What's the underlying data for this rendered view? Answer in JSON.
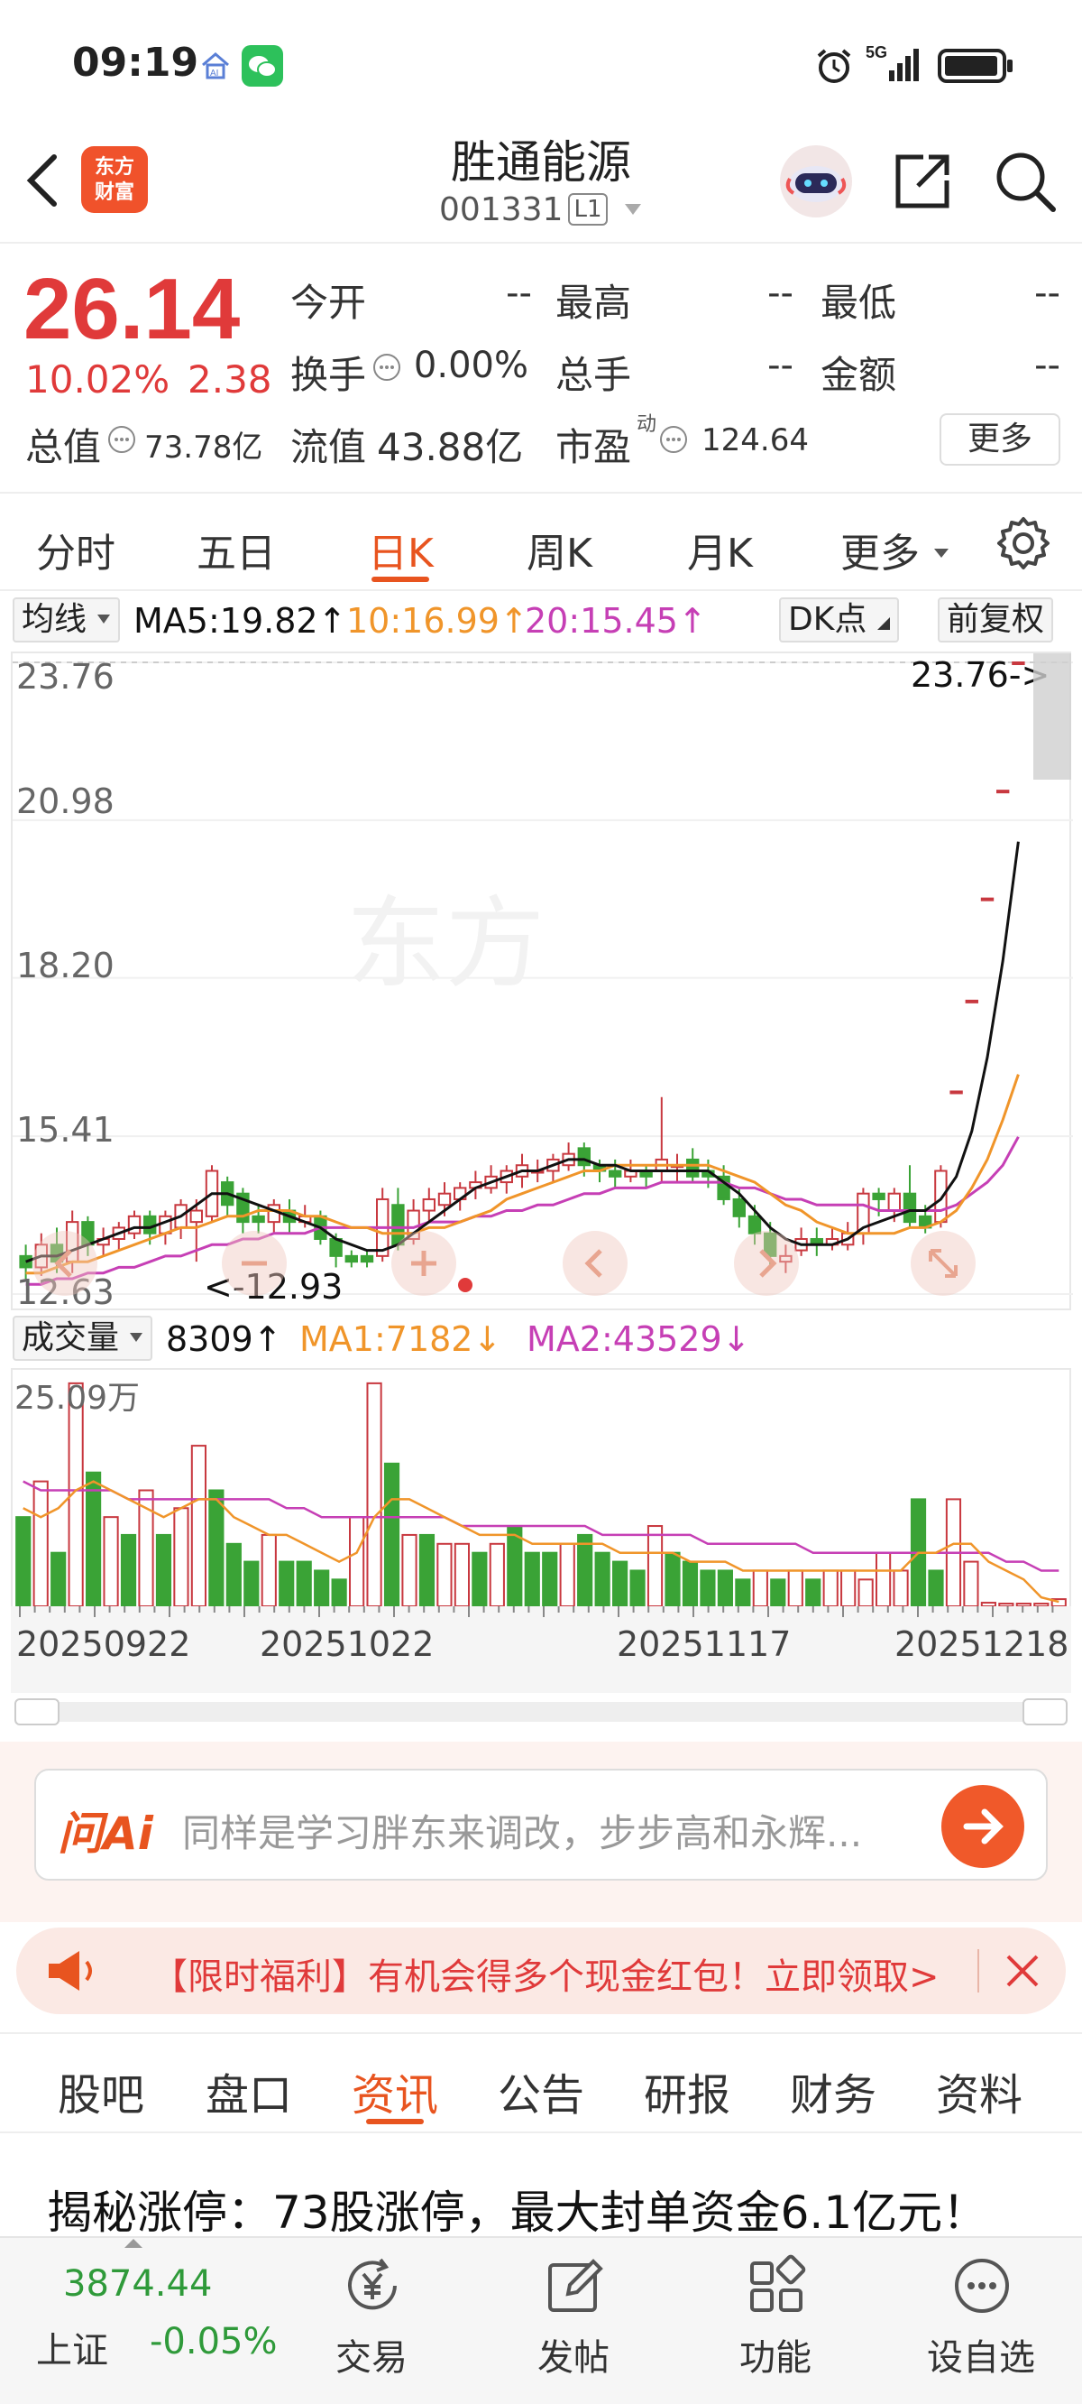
{
  "status_bar": {
    "time": "09:19",
    "network": "5G",
    "icons": [
      "home-ai-icon",
      "wechat-icon",
      "alarm-icon",
      "signal-icon",
      "battery-icon"
    ]
  },
  "header": {
    "back_icon": "back-chevron-icon",
    "logo_text_line1": "东方",
    "logo_text_line2": "财富",
    "stock_name": "胜通能源",
    "stock_code": "001331",
    "level_badge": "L1",
    "actions": [
      "robot-avatar-icon",
      "share-icon",
      "search-icon"
    ]
  },
  "quote": {
    "price": "26.14",
    "change_pct": "10.02%",
    "change_abs": "2.38",
    "open_label": "今开",
    "open_value": "--",
    "high_label": "最高",
    "high_value": "--",
    "low_label": "最低",
    "low_value": "--",
    "turnover_label": "换手",
    "turnover_value": "0.00%",
    "volume_label": "总手",
    "volume_value": "--",
    "amount_label": "金额",
    "amount_value": "--",
    "mktcap_label": "总值",
    "mktcap_value": "73.78亿",
    "float_label": "流值",
    "float_value": "43.88亿",
    "pe_label": "市盈",
    "pe_sup": "动",
    "pe_value": "124.64",
    "more_label": "更多",
    "accent_color": "#e03a3a"
  },
  "period_tabs": {
    "items": [
      "分时",
      "五日",
      "日K",
      "周K",
      "月K",
      "更多"
    ],
    "active": "日K",
    "settings_icon": "gear-icon"
  },
  "ma_legend": {
    "selector": "均线",
    "ma5": "MA5:19.82",
    "ma10": "10:16.99",
    "ma20": "20:15.45",
    "dk_button": "DK点",
    "adjust_button": "前复权"
  },
  "volume_legend": {
    "selector": "成交量",
    "volume": "8309",
    "ma1": "MA1:7182",
    "ma2": "MA2:43529",
    "max_label": "25.09万"
  },
  "chart_data": {
    "type": "candlestick",
    "price_axis_labels": [
      "23.76",
      "20.98",
      "18.20",
      "15.41",
      "12.63"
    ],
    "max_marker": "23.76->",
    "min_marker": "<-12.93",
    "date_labels": [
      "20250922",
      "20251022",
      "20251117",
      "20251218"
    ],
    "ylim": [
      12.63,
      23.76
    ],
    "colors": {
      "up": "#c8383f",
      "down": "#3aa336",
      "ma5": "#111111",
      "ma10": "#f0952a",
      "ma20": "#c63fb5"
    },
    "candles": [
      {
        "o": 13.3,
        "c": 13.1,
        "h": 13.5,
        "l": 12.9
      },
      {
        "o": 13.1,
        "c": 13.5,
        "h": 13.7,
        "l": 12.95
      },
      {
        "o": 13.5,
        "c": 13.2,
        "h": 13.8,
        "l": 13.0
      },
      {
        "o": 13.2,
        "c": 13.9,
        "h": 14.1,
        "l": 13.0
      },
      {
        "o": 13.9,
        "c": 13.5,
        "h": 14.0,
        "l": 13.3
      },
      {
        "o": 13.5,
        "c": 13.6,
        "h": 13.8,
        "l": 13.3
      },
      {
        "o": 13.6,
        "c": 13.8,
        "h": 13.9,
        "l": 13.4
      },
      {
        "o": 13.7,
        "c": 14.0,
        "h": 14.1,
        "l": 13.6
      },
      {
        "o": 14.0,
        "c": 13.7,
        "h": 14.1,
        "l": 13.5
      },
      {
        "o": 13.7,
        "c": 14.0,
        "h": 14.1,
        "l": 13.5
      },
      {
        "o": 13.8,
        "c": 14.2,
        "h": 14.3,
        "l": 13.6
      },
      {
        "o": 13.9,
        "c": 14.1,
        "h": 14.3,
        "l": 13.2
      },
      {
        "o": 14.0,
        "c": 14.8,
        "h": 14.9,
        "l": 13.9
      },
      {
        "o": 14.6,
        "c": 14.2,
        "h": 14.7,
        "l": 14.0
      },
      {
        "o": 14.4,
        "c": 13.9,
        "h": 14.5,
        "l": 13.7
      },
      {
        "o": 14.0,
        "c": 13.9,
        "h": 14.2,
        "l": 13.7
      },
      {
        "o": 13.9,
        "c": 14.2,
        "h": 14.3,
        "l": 13.7
      },
      {
        "o": 14.1,
        "c": 13.9,
        "h": 14.3,
        "l": 13.7
      },
      {
        "o": 13.9,
        "c": 14.0,
        "h": 14.2,
        "l": 13.8
      },
      {
        "o": 14.0,
        "c": 13.6,
        "h": 14.1,
        "l": 13.5
      },
      {
        "o": 13.6,
        "c": 13.3,
        "h": 13.7,
        "l": 13.1
      },
      {
        "o": 13.3,
        "c": 13.2,
        "h": 13.4,
        "l": 13.1
      },
      {
        "o": 13.3,
        "c": 13.2,
        "h": 13.4,
        "l": 13.1
      },
      {
        "o": 13.3,
        "c": 14.3,
        "h": 14.5,
        "l": 13.2
      },
      {
        "o": 14.2,
        "c": 13.5,
        "h": 14.5,
        "l": 13.4
      },
      {
        "o": 13.6,
        "c": 14.1,
        "h": 14.3,
        "l": 13.5
      },
      {
        "o": 14.1,
        "c": 14.3,
        "h": 14.5,
        "l": 13.9
      },
      {
        "o": 14.2,
        "c": 14.4,
        "h": 14.6,
        "l": 14.0
      },
      {
        "o": 14.3,
        "c": 14.5,
        "h": 14.6,
        "l": 14.1
      },
      {
        "o": 14.5,
        "c": 14.6,
        "h": 14.8,
        "l": 14.3
      },
      {
        "o": 14.5,
        "c": 14.7,
        "h": 14.9,
        "l": 14.4
      },
      {
        "o": 14.6,
        "c": 14.8,
        "h": 14.9,
        "l": 14.4
      },
      {
        "o": 14.7,
        "c": 14.9,
        "h": 15.1,
        "l": 14.5
      },
      {
        "o": 14.8,
        "c": 14.8,
        "h": 15.0,
        "l": 14.6
      },
      {
        "o": 14.8,
        "c": 15.0,
        "h": 15.1,
        "l": 14.6
      },
      {
        "o": 14.9,
        "c": 15.1,
        "h": 15.3,
        "l": 14.8
      },
      {
        "o": 15.2,
        "c": 14.9,
        "h": 15.3,
        "l": 14.7
      },
      {
        "o": 14.9,
        "c": 14.8,
        "h": 15.0,
        "l": 14.6
      },
      {
        "o": 14.8,
        "c": 14.7,
        "h": 15.0,
        "l": 14.5
      },
      {
        "o": 14.7,
        "c": 14.8,
        "h": 15.0,
        "l": 14.6
      },
      {
        "o": 14.8,
        "c": 14.7,
        "h": 14.9,
        "l": 14.5
      },
      {
        "o": 14.8,
        "c": 15.0,
        "h": 16.1,
        "l": 14.6
      },
      {
        "o": 14.9,
        "c": 14.9,
        "h": 15.1,
        "l": 14.6
      },
      {
        "o": 15.0,
        "c": 14.7,
        "h": 15.2,
        "l": 14.6
      },
      {
        "o": 14.8,
        "c": 14.7,
        "h": 15.0,
        "l": 14.5
      },
      {
        "o": 14.7,
        "c": 14.3,
        "h": 14.9,
        "l": 14.2
      },
      {
        "o": 14.3,
        "c": 14.0,
        "h": 14.5,
        "l": 13.8
      },
      {
        "o": 14.0,
        "c": 13.7,
        "h": 14.2,
        "l": 13.5
      },
      {
        "o": 13.7,
        "c": 13.3,
        "h": 13.9,
        "l": 13.1
      },
      {
        "o": 13.2,
        "c": 13.3,
        "h": 13.5,
        "l": 13.0
      },
      {
        "o": 13.4,
        "c": 13.6,
        "h": 13.8,
        "l": 13.3
      },
      {
        "o": 13.6,
        "c": 13.5,
        "h": 13.8,
        "l": 13.3
      },
      {
        "o": 13.5,
        "c": 13.6,
        "h": 13.8,
        "l": 13.4
      },
      {
        "o": 13.5,
        "c": 13.7,
        "h": 13.9,
        "l": 13.4
      },
      {
        "o": 13.7,
        "c": 14.4,
        "h": 14.5,
        "l": 13.5
      },
      {
        "o": 14.4,
        "c": 14.3,
        "h": 14.5,
        "l": 14.0
      },
      {
        "o": 14.1,
        "c": 14.4,
        "h": 14.5,
        "l": 13.9
      },
      {
        "o": 14.4,
        "c": 13.9,
        "h": 14.9,
        "l": 13.8
      },
      {
        "o": 14.0,
        "c": 13.8,
        "h": 14.2,
        "l": 13.7
      },
      {
        "o": 13.9,
        "c": 14.8,
        "h": 14.9,
        "l": 13.8
      },
      {
        "o": 16.2,
        "c": 16.2,
        "h": 16.2,
        "l": 16.2
      },
      {
        "o": 17.8,
        "c": 17.8,
        "h": 17.8,
        "l": 17.8
      },
      {
        "o": 19.6,
        "c": 19.6,
        "h": 19.6,
        "l": 19.6
      },
      {
        "o": 21.5,
        "c": 21.5,
        "h": 21.5,
        "l": 21.5
      },
      {
        "o": 23.76,
        "c": 23.76,
        "h": 23.76,
        "l": 23.76
      }
    ],
    "ma5": [
      13.2,
      13.3,
      13.3,
      13.4,
      13.5,
      13.6,
      13.7,
      13.8,
      13.8,
      13.9,
      14.0,
      14.2,
      14.4,
      14.4,
      14.3,
      14.2,
      14.1,
      14.0,
      13.9,
      13.8,
      13.6,
      13.5,
      13.4,
      13.4,
      13.5,
      13.7,
      13.9,
      14.1,
      14.3,
      14.5,
      14.6,
      14.7,
      14.8,
      14.8,
      14.9,
      15.0,
      15.0,
      14.9,
      14.9,
      14.8,
      14.8,
      14.8,
      14.8,
      14.8,
      14.8,
      14.6,
      14.4,
      14.1,
      13.8,
      13.6,
      13.5,
      13.5,
      13.5,
      13.6,
      13.8,
      13.9,
      14.0,
      14.1,
      14.1,
      14.3,
      14.7,
      15.5,
      16.8,
      18.5,
      20.6
    ],
    "ma10": [
      13.0,
      13.0,
      13.1,
      13.2,
      13.2,
      13.3,
      13.4,
      13.5,
      13.6,
      13.7,
      13.8,
      13.8,
      13.9,
      14.0,
      14.0,
      14.1,
      14.1,
      14.1,
      14.0,
      14.0,
      13.9,
      13.8,
      13.8,
      13.7,
      13.7,
      13.7,
      13.8,
      13.8,
      13.9,
      14.0,
      14.1,
      14.3,
      14.4,
      14.5,
      14.6,
      14.7,
      14.8,
      14.8,
      14.9,
      14.9,
      14.9,
      14.9,
      14.9,
      14.9,
      14.9,
      14.8,
      14.7,
      14.6,
      14.4,
      14.2,
      14.1,
      13.9,
      13.8,
      13.7,
      13.7,
      13.7,
      13.7,
      13.8,
      13.8,
      13.9,
      14.1,
      14.5,
      15.0,
      15.7,
      16.5
    ],
    "ma20": [
      12.8,
      12.8,
      12.9,
      12.9,
      13.0,
      13.0,
      13.1,
      13.1,
      13.2,
      13.3,
      13.3,
      13.4,
      13.5,
      13.5,
      13.6,
      13.6,
      13.7,
      13.7,
      13.7,
      13.8,
      13.8,
      13.8,
      13.8,
      13.8,
      13.8,
      13.8,
      13.9,
      13.9,
      13.9,
      14.0,
      14.0,
      14.1,
      14.1,
      14.2,
      14.2,
      14.3,
      14.4,
      14.4,
      14.5,
      14.5,
      14.5,
      14.6,
      14.6,
      14.6,
      14.6,
      14.6,
      14.5,
      14.5,
      14.4,
      14.3,
      14.3,
      14.2,
      14.2,
      14.2,
      14.2,
      14.1,
      14.1,
      14.1,
      14.1,
      14.1,
      14.2,
      14.4,
      14.6,
      14.9,
      15.4
    ],
    "volume_unit": "万",
    "volumes": [
      {
        "v": 10,
        "up": false
      },
      {
        "v": 14,
        "up": true
      },
      {
        "v": 6,
        "up": false
      },
      {
        "v": 25,
        "up": true
      },
      {
        "v": 15,
        "up": false
      },
      {
        "v": 10,
        "up": true
      },
      {
        "v": 8,
        "up": false
      },
      {
        "v": 13,
        "up": true
      },
      {
        "v": 8,
        "up": false
      },
      {
        "v": 11,
        "up": true
      },
      {
        "v": 18,
        "up": true
      },
      {
        "v": 13,
        "up": false
      },
      {
        "v": 7,
        "up": false
      },
      {
        "v": 5,
        "up": false
      },
      {
        "v": 8,
        "up": true
      },
      {
        "v": 5,
        "up": false
      },
      {
        "v": 5,
        "up": false
      },
      {
        "v": 4,
        "up": false
      },
      {
        "v": 3,
        "up": false
      },
      {
        "v": 10,
        "up": true
      },
      {
        "v": 25,
        "up": true
      },
      {
        "v": 16,
        "up": false
      },
      {
        "v": 8,
        "up": true
      },
      {
        "v": 8,
        "up": false
      },
      {
        "v": 7,
        "up": true
      },
      {
        "v": 7,
        "up": true
      },
      {
        "v": 6,
        "up": false
      },
      {
        "v": 7,
        "up": true
      },
      {
        "v": 9,
        "up": false
      },
      {
        "v": 6,
        "up": false
      },
      {
        "v": 6,
        "up": false
      },
      {
        "v": 7,
        "up": true
      },
      {
        "v": 8,
        "up": false
      },
      {
        "v": 6,
        "up": false
      },
      {
        "v": 5,
        "up": false
      },
      {
        "v": 4,
        "up": false
      },
      {
        "v": 9,
        "up": true
      },
      {
        "v": 6,
        "up": false
      },
      {
        "v": 5,
        "up": false
      },
      {
        "v": 4,
        "up": false
      },
      {
        "v": 4,
        "up": false
      },
      {
        "v": 3,
        "up": false
      },
      {
        "v": 4,
        "up": true
      },
      {
        "v": 3,
        "up": false
      },
      {
        "v": 4,
        "up": true
      },
      {
        "v": 3,
        "up": false
      },
      {
        "v": 4,
        "up": true
      },
      {
        "v": 4,
        "up": true
      },
      {
        "v": 3,
        "up": true
      },
      {
        "v": 6,
        "up": true
      },
      {
        "v": 4,
        "up": true
      },
      {
        "v": 12,
        "up": false
      },
      {
        "v": 4,
        "up": false
      },
      {
        "v": 12,
        "up": true
      },
      {
        "v": 5,
        "up": true
      },
      {
        "v": 0.4,
        "up": true
      },
      {
        "v": 0.3,
        "up": true
      },
      {
        "v": 0.3,
        "up": true
      },
      {
        "v": 0.3,
        "up": true
      },
      {
        "v": 0.8,
        "up": true
      }
    ],
    "vol_ma1": [
      11,
      10,
      11,
      13,
      14,
      13,
      12,
      11,
      10,
      11,
      12,
      12,
      10,
      9,
      8,
      8,
      7,
      6,
      5,
      6,
      10,
      12,
      12,
      11,
      10,
      9,
      8,
      8,
      8,
      7,
      7,
      7,
      7,
      7,
      6,
      6,
      6,
      6,
      5,
      5,
      5,
      4,
      4,
      4,
      4,
      4,
      4,
      4,
      4,
      4,
      4,
      6,
      6,
      7,
      7,
      5,
      4,
      3,
      1,
      0.5
    ],
    "vol_ma2": [
      14,
      13,
      13,
      13,
      13,
      13,
      12,
      12,
      12,
      12,
      12,
      12,
      12,
      12,
      12,
      11,
      11,
      10,
      10,
      10,
      10,
      10,
      10,
      10,
      10,
      9,
      9,
      9,
      9,
      9,
      9,
      9,
      9,
      8,
      8,
      8,
      8,
      8,
      8,
      7,
      7,
      7,
      7,
      7,
      7,
      6,
      6,
      6,
      6,
      6,
      6,
      6,
      6,
      6,
      6,
      6,
      5,
      5,
      4,
      4
    ]
  },
  "chart_nav": {
    "prev_icon": "chevron-left-icon",
    "next_icon": "chevron-right-icon",
    "zoom_out_icon": "minus-icon",
    "zoom_in_icon": "plus-icon",
    "expand_icon": "expand-icon"
  },
  "ai_bar": {
    "logo": "问Ai",
    "placeholder": "同样是学习胖东来调改，步步高和永辉...",
    "go_icon": "arrow-right-icon"
  },
  "promo": {
    "text": "【限时福利】有机会得多个现金红包！立即领取>",
    "speaker_icon": "speaker-icon",
    "close_icon": "close-icon"
  },
  "news_tabs": {
    "items": [
      "股吧",
      "盘口",
      "资讯",
      "公告",
      "研报",
      "财务",
      "资料"
    ],
    "active": "资讯"
  },
  "headline": "揭秘涨停：73股涨停，最大封单资金6.1亿元！",
  "bottom_bar": {
    "index_value": "3874.44",
    "index_name": "上证",
    "index_change": "-0.05%",
    "items": [
      {
        "label": "交易",
        "icon": "trade-yen-icon"
      },
      {
        "label": "发帖",
        "icon": "post-edit-icon"
      },
      {
        "label": "功能",
        "icon": "grid-apps-icon"
      },
      {
        "label": "设自选",
        "icon": "chat-more-icon"
      }
    ]
  }
}
